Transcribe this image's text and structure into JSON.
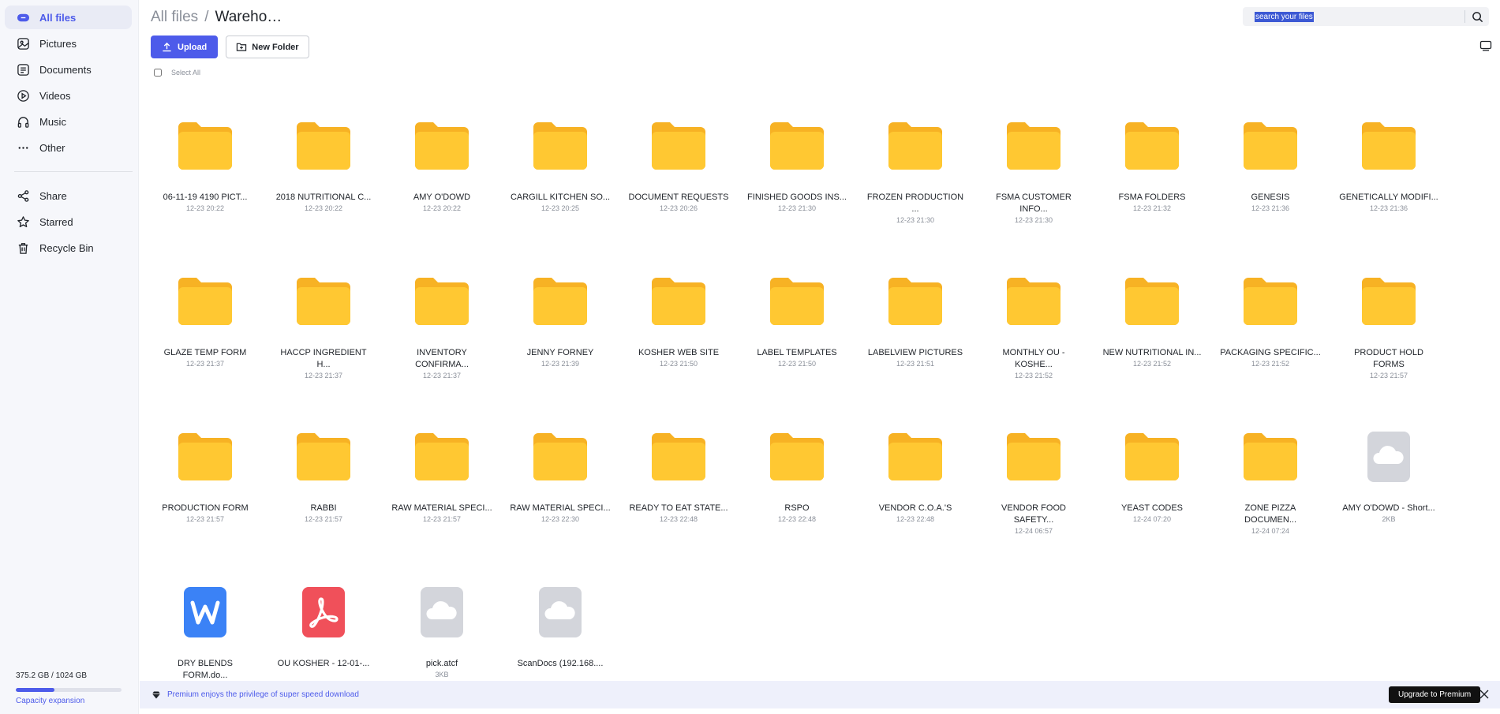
{
  "sidebar": {
    "items": [
      {
        "label": "All files",
        "icon": "all-files-icon",
        "active": true
      },
      {
        "label": "Pictures",
        "icon": "pictures-icon"
      },
      {
        "label": "Documents",
        "icon": "documents-icon"
      },
      {
        "label": "Videos",
        "icon": "videos-icon"
      },
      {
        "label": "Music",
        "icon": "music-icon"
      },
      {
        "label": "Other",
        "icon": "other-icon"
      }
    ],
    "items2": [
      {
        "label": "Share",
        "icon": "share-icon"
      },
      {
        "label": "Starred",
        "icon": "star-icon"
      },
      {
        "label": "Recycle Bin",
        "icon": "trash-icon"
      }
    ],
    "capacity_text": "375.2 GB / 1024 GB",
    "capacity_fraction": 0.366,
    "capacity_link": "Capacity expansion"
  },
  "header": {
    "breadcrumb_root": "All files",
    "breadcrumb_sep": "/",
    "breadcrumb_current": "Wareho…",
    "search_placeholder": "search your files",
    "upload_label": "Upload",
    "new_folder_label": "New Folder",
    "select_all_label": "Select All"
  },
  "files": [
    {
      "name": "06-11-19 4190 PICT...",
      "meta": "12-23 20:22",
      "type": "folder"
    },
    {
      "name": "2018 NUTRITIONAL C...",
      "meta": "12-23 20:22",
      "type": "folder"
    },
    {
      "name": "AMY O'DOWD",
      "meta": "12-23 20:22",
      "type": "folder"
    },
    {
      "name": "CARGILL KITCHEN SO...",
      "meta": "12-23 20:25",
      "type": "folder"
    },
    {
      "name": "DOCUMENT REQUESTS",
      "meta": "12-23 20:26",
      "type": "folder"
    },
    {
      "name": "FINISHED GOODS INS...",
      "meta": "12-23 21:30",
      "type": "folder"
    },
    {
      "name": "FROZEN PRODUCTION ...",
      "meta": "12-23 21:30",
      "type": "folder"
    },
    {
      "name": "FSMA CUSTOMER INFO...",
      "meta": "12-23 21:30",
      "type": "folder"
    },
    {
      "name": "FSMA FOLDERS",
      "meta": "12-23 21:32",
      "type": "folder"
    },
    {
      "name": "GENESIS",
      "meta": "12-23 21:36",
      "type": "folder"
    },
    {
      "name": "GENETICALLY MODIFI...",
      "meta": "12-23 21:36",
      "type": "folder"
    },
    {
      "name": "GLAZE TEMP FORM",
      "meta": "12-23 21:37",
      "type": "folder"
    },
    {
      "name": "HACCP INGREDIENT H...",
      "meta": "12-23 21:37",
      "type": "folder"
    },
    {
      "name": "INVENTORY CONFIRMA...",
      "meta": "12-23 21:37",
      "type": "folder"
    },
    {
      "name": "JENNY FORNEY",
      "meta": "12-23 21:39",
      "type": "folder"
    },
    {
      "name": "KOSHER WEB SITE",
      "meta": "12-23 21:50",
      "type": "folder"
    },
    {
      "name": "LABEL TEMPLATES",
      "meta": "12-23 21:50",
      "type": "folder"
    },
    {
      "name": "LABELVIEW PICTURES",
      "meta": "12-23 21:51",
      "type": "folder"
    },
    {
      "name": "MONTHLY OU - KOSHE...",
      "meta": "12-23 21:52",
      "type": "folder"
    },
    {
      "name": "NEW NUTRITIONAL IN...",
      "meta": "12-23 21:52",
      "type": "folder"
    },
    {
      "name": "PACKAGING SPECIFIC...",
      "meta": "12-23 21:52",
      "type": "folder"
    },
    {
      "name": "PRODUCT HOLD FORMS",
      "meta": "12-23 21:57",
      "type": "folder"
    },
    {
      "name": "PRODUCTION FORM",
      "meta": "12-23 21:57",
      "type": "folder"
    },
    {
      "name": "RABBI",
      "meta": "12-23 21:57",
      "type": "folder"
    },
    {
      "name": "RAW MATERIAL SPECI...",
      "meta": "12-23 21:57",
      "type": "folder"
    },
    {
      "name": "RAW MATERIAL SPECI...",
      "meta": "12-23 22:30",
      "type": "folder"
    },
    {
      "name": "READY TO EAT STATE...",
      "meta": "12-23 22:48",
      "type": "folder"
    },
    {
      "name": "RSPO",
      "meta": "12-23 22:48",
      "type": "folder"
    },
    {
      "name": "VENDOR C.O.A.'S",
      "meta": "12-23 22:48",
      "type": "folder"
    },
    {
      "name": "VENDOR FOOD SAFETY...",
      "meta": "12-24 06:57",
      "type": "folder"
    },
    {
      "name": "YEAST CODES",
      "meta": "12-24 07:20",
      "type": "folder"
    },
    {
      "name": "ZONE PIZZA DOCUMEN...",
      "meta": "12-24 07:24",
      "type": "folder"
    },
    {
      "name": "AMY O'DOWD - Short...",
      "meta": "2KB",
      "type": "cloud"
    },
    {
      "name": "DRY BLENDS FORM.do...",
      "meta": "",
      "type": "word"
    },
    {
      "name": "OU KOSHER - 12-01-...",
      "meta": "",
      "type": "pdf"
    },
    {
      "name": "pick.atcf",
      "meta": "3KB",
      "type": "cloud"
    },
    {
      "name": "ScanDocs (192.168....",
      "meta": "",
      "type": "cloud"
    }
  ],
  "banner": {
    "text": "Premium enjoys the privilege of super speed download",
    "button": "Upgrade to Premium"
  },
  "colors": {
    "accent": "#4d5bea",
    "folder": "#ffc832",
    "word": "#3b82f6",
    "pdf": "#f0505a"
  }
}
